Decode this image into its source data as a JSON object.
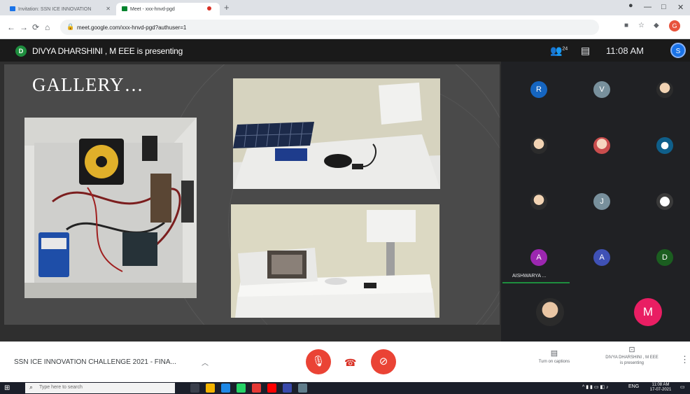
{
  "browser": {
    "tabs": [
      {
        "label": "Invitation: SSN ICE INNOVATION",
        "active": false
      },
      {
        "label": "Meet - xxx-hnvd-pgd",
        "active": true
      }
    ],
    "new_tab_symbol": "+",
    "window_controls": [
      "—",
      "□",
      "✕"
    ],
    "url": "meet.google.com/xxx-hnvd-pgd?authuser=1",
    "nav": {
      "back": "←",
      "forward": "→",
      "reload": "⟳",
      "home": "⌂"
    },
    "profile_initial": "G"
  },
  "meet": {
    "presenter_initial": "D",
    "presenter_text": "DIVYA DHARSHINI , M EEE is presenting",
    "participant_count": "24",
    "time": "11:08 AM",
    "self_initial": "S"
  },
  "slide": {
    "title": "GALLERY…"
  },
  "participants": [
    {
      "initial": "R",
      "color": "#1565c0",
      "photo": false
    },
    {
      "initial": "V",
      "color": "#78909c",
      "photo": false
    },
    {
      "initial": "",
      "color": "#2c2c2c",
      "photo": true
    },
    {
      "initial": "",
      "color": "#2c2c2c",
      "photo": true
    },
    {
      "initial": "",
      "color": "#2c2c2c",
      "photo": true
    },
    {
      "initial": "",
      "color": "#0f5f8a",
      "photo": true
    },
    {
      "initial": "",
      "color": "#2c2c2c",
      "photo": true
    },
    {
      "initial": "J",
      "color": "#78909c",
      "photo": false
    },
    {
      "initial": "",
      "color": "#2c2c2c",
      "photo": true
    },
    {
      "initial": "A",
      "color": "#9c27b0",
      "photo": false
    },
    {
      "initial": "A",
      "color": "#3f51b5",
      "photo": false
    },
    {
      "initial": "D",
      "color": "#1b5e20",
      "photo": false
    }
  ],
  "speaking_name": "AISHWARYA ...",
  "large_tiles": [
    {
      "initial": "",
      "color": "#2c2c2c",
      "photo": true
    },
    {
      "initial": "M",
      "color": "#e91e63",
      "photo": false
    }
  ],
  "bottom": {
    "meeting_title": "SSN ICE INNOVATION CHALLENGE 2021 - FINA...",
    "captions_label": "Turn on captions",
    "presenting_label_1": "DIVYA DHARSHINI , M EEE",
    "presenting_label_2": "is presenting"
  },
  "taskbar": {
    "search_placeholder": "Type here to search",
    "time": "11:08 AM",
    "date": "17-07-2021",
    "lang": "ENG"
  },
  "colors": {
    "danger": "#ea4335",
    "meet_dark": "#202124",
    "slide_bg": "#4a4a4a"
  }
}
